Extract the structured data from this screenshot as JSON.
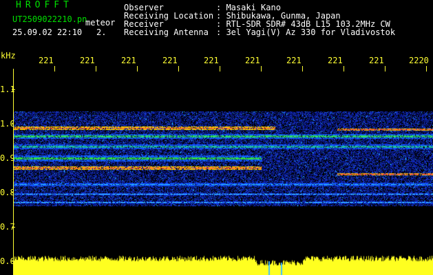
{
  "header": {
    "brand": "HROFFT",
    "filename": "UT2509022210.pn",
    "mode": "meteor",
    "datetime": "25.09.02 22:10",
    "index": "2."
  },
  "info": {
    "labels": [
      "Observer",
      "Receiving Location",
      "Receiver",
      "Receiving Antenna"
    ],
    "values": [
      ": Masaki Kano",
      ": Shibukawa, Gunma, Japan",
      ": RTL-SDR SDR# 43dB L15 103.2MHz CW",
      ": 3el Yagi(V) Az 330 for Vladivostok"
    ]
  },
  "yaxis": {
    "unit": "kHz",
    "labels": [
      "1.1",
      "1.0",
      "0.9",
      "0.8",
      "0.7",
      "0.6"
    ]
  },
  "xaxis": {
    "labels": [
      "221",
      "221",
      "221",
      "221",
      "221",
      "221",
      "221",
      "221",
      "221",
      "2220"
    ]
  },
  "colors": {
    "axis": "#ffff33",
    "text": "#ffffff",
    "brand": "#00e000",
    "background": "#000000",
    "noise": "#0a1a9e"
  }
}
